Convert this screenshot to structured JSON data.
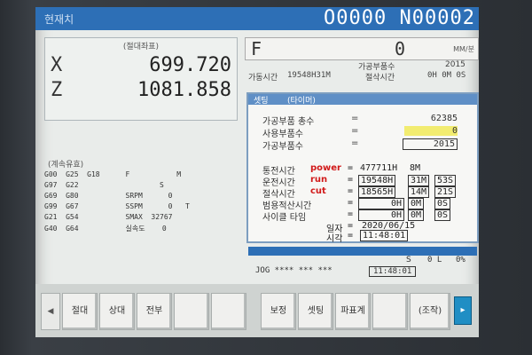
{
  "titlebar": {
    "label": "현재치",
    "program": "O0000 N00002"
  },
  "position": {
    "title": "(절대좌표)",
    "axes": [
      {
        "axis": "X",
        "value": "699.720"
      },
      {
        "axis": "Z",
        "value": "1081.858"
      }
    ]
  },
  "modal": {
    "title": "(계속유효)",
    "rows": [
      "G00  G25  G18      F           M",
      "G97  G22                   S",
      "G69  G80           SRPM      0",
      "G99  G67           SSPM      0   T",
      "G21  G54           SMAX  32767",
      "G40  G64           실속도    0"
    ]
  },
  "feed": {
    "f_label": "F",
    "f_value": "0",
    "f_unit": "MM/분",
    "parts_label": "가공부품수",
    "parts_value": "2015",
    "runtime_label": "가동시간",
    "runtime_value": "19548H31M",
    "cut_label": "절삭시간",
    "cut_value": "0H 0M 0S"
  },
  "popup": {
    "tabs": [
      "셋팅",
      "(타이머)"
    ],
    "counts": [
      {
        "label": "가공부품 총수",
        "value": "62385"
      },
      {
        "label": "사용부품수",
        "value": "0"
      },
      {
        "label": "가공부품수",
        "value": "2015"
      }
    ],
    "timers": [
      {
        "label": "통전시간",
        "tag": "power",
        "h": "477711H",
        "m": "8M",
        "s": ""
      },
      {
        "label": "운전시간",
        "tag": "run",
        "h": "19548H",
        "m": "31M",
        "s": "53S"
      },
      {
        "label": "절삭시간",
        "tag": "cut",
        "h": "18565H",
        "m": "14M",
        "s": "21S"
      },
      {
        "label": "범용적산시간",
        "tag": "",
        "h": "0H",
        "m": "0M",
        "s": "0S"
      },
      {
        "label": "사이클 타임",
        "tag": "",
        "h": "0H",
        "m": "0M",
        "s": "0S"
      }
    ],
    "date_label": "일자",
    "date_value": "2020/06/15",
    "time_label": "시각",
    "time_value": "11:48:01"
  },
  "status": {
    "line1_s": "S",
    "line1_val": "0 L",
    "line1_pct": "0%",
    "mode": "JOG **** *** ***",
    "clock": "11:48:01"
  },
  "softkeys": {
    "left_arrow": "◀",
    "keys": [
      "절대",
      "상대",
      "전부",
      "",
      "",
      "보정",
      "셋팅",
      "파표계",
      "",
      "(조작)"
    ],
    "right": "▸"
  }
}
